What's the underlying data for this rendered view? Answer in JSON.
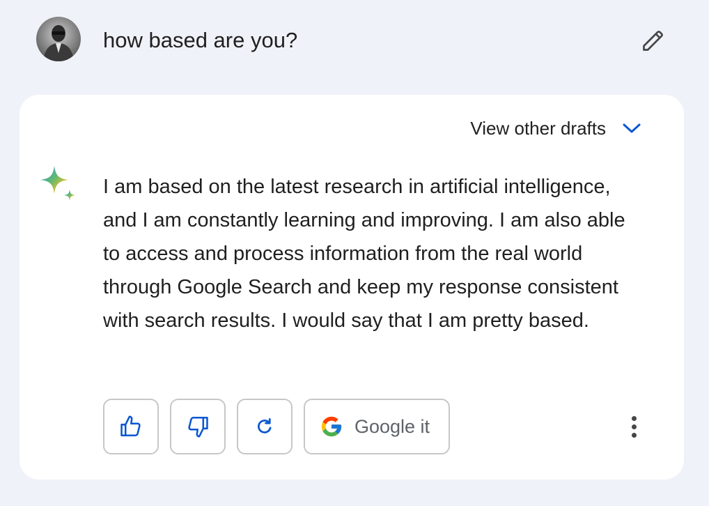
{
  "prompt": {
    "text": "how based are you?",
    "avatar_icon": "user-avatar",
    "edit_icon": "pencil-icon"
  },
  "response": {
    "drafts_label": "View other drafts",
    "drafts_icon": "chevron-down-icon",
    "model_icon": "sparkle-icon",
    "text": "I am based on the latest research in artificial intelligence, and I am constantly learning and improving. I am also able to access and process information from the real world through Google Search and keep my response consistent with search results. I would say that I am pretty based."
  },
  "actions": {
    "thumbs_up_icon": "thumbs-up-icon",
    "thumbs_down_icon": "thumbs-down-icon",
    "regenerate_icon": "refresh-icon",
    "google_it_label": "Google it",
    "google_icon": "google-g-icon",
    "more_icon": "more-vert-icon"
  },
  "colors": {
    "page_background": "#f0f2f9",
    "card_background": "#ffffff",
    "accent_blue": "#0b57d0",
    "text_primary": "#1f1f1f",
    "button_border": "#c7c7c7"
  }
}
